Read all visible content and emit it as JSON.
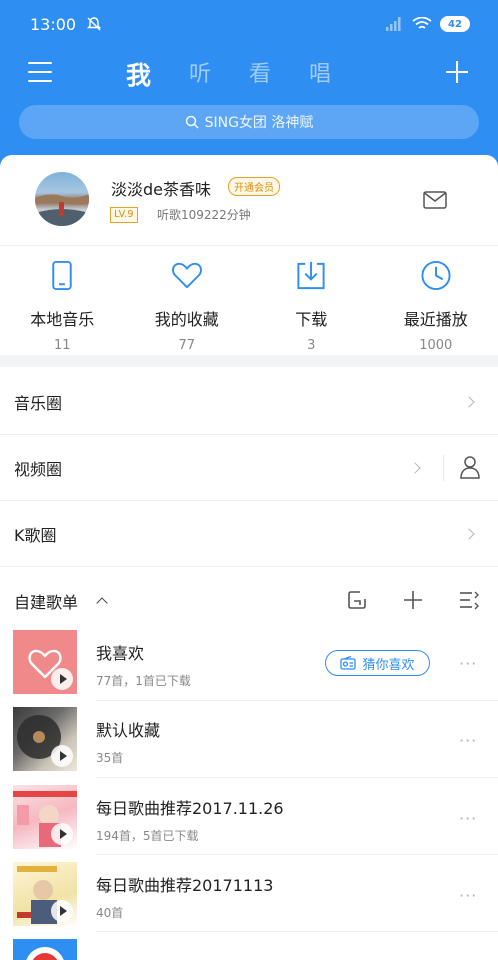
{
  "status_bar": {
    "time": "13:00",
    "battery": "42"
  },
  "nav": {
    "tabs": [
      {
        "label": "我",
        "active": true
      },
      {
        "label": "听",
        "active": false
      },
      {
        "label": "看",
        "active": false
      },
      {
        "label": "唱",
        "active": false
      }
    ]
  },
  "search": {
    "placeholder": "SING女团 洛神赋"
  },
  "profile": {
    "username": "淡淡de茶香味",
    "vip_label": "开通会员",
    "level": "LV.9",
    "listen_time": "听歌109222分钟"
  },
  "quick_links": [
    {
      "label": "本地音乐",
      "count": "11",
      "icon": "phone-icon"
    },
    {
      "label": "我的收藏",
      "count": "77",
      "icon": "heart-icon"
    },
    {
      "label": "下载",
      "count": "3",
      "icon": "download-icon"
    },
    {
      "label": "最近播放",
      "count": "1000",
      "icon": "clock-icon"
    }
  ],
  "circles": [
    {
      "label": "音乐圈"
    },
    {
      "label": "视频圈"
    },
    {
      "label": "K歌圈"
    }
  ],
  "playlists": {
    "header": "自建歌单",
    "guess_button": "猜你喜欢",
    "items": [
      {
        "name": "我喜欢",
        "meta": "77首，1首已下载"
      },
      {
        "name": "默认收藏",
        "meta": "35首"
      },
      {
        "name": "每日歌曲推荐2017.11.26",
        "meta": "194首，5首已下载"
      },
      {
        "name": "每日歌曲推荐20171113",
        "meta": "40首"
      }
    ]
  },
  "colors": {
    "accent": "#2f8ef2",
    "vip": "#e6a22b",
    "heart_cover": "#f08a8a"
  }
}
